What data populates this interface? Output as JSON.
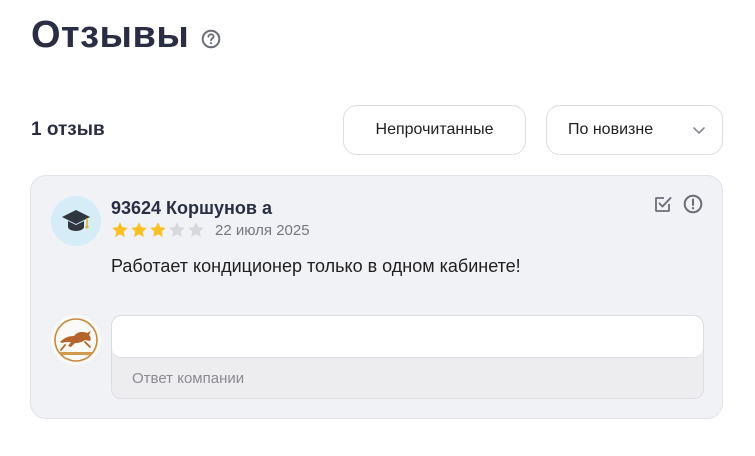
{
  "header": {
    "title": "Отзывы",
    "help_icon": "question-circle-icon"
  },
  "toolbar": {
    "count_label": "1 отзыв",
    "unread_button": "Непрочитанные",
    "sort_selected": "По новизне",
    "sort_icon": "chevron-down-icon"
  },
  "review": {
    "author": "93624 Коршунов а",
    "avatar_icon": "graduation-cap-icon",
    "rating": 3,
    "rating_max": 5,
    "date": "22 июля 2025",
    "text": "Работает кондиционер только в одном кабинете!",
    "actions": [
      "mark-read-icon",
      "report-icon"
    ]
  },
  "reply": {
    "company_logo_icon": "company-logo-icon",
    "placeholder": "Ответ компании",
    "value": ""
  },
  "colors": {
    "accent_star": "#fbc025",
    "star_empty": "#d7d8de",
    "card_bg": "#f1f2f6",
    "title": "#2a2e44"
  }
}
